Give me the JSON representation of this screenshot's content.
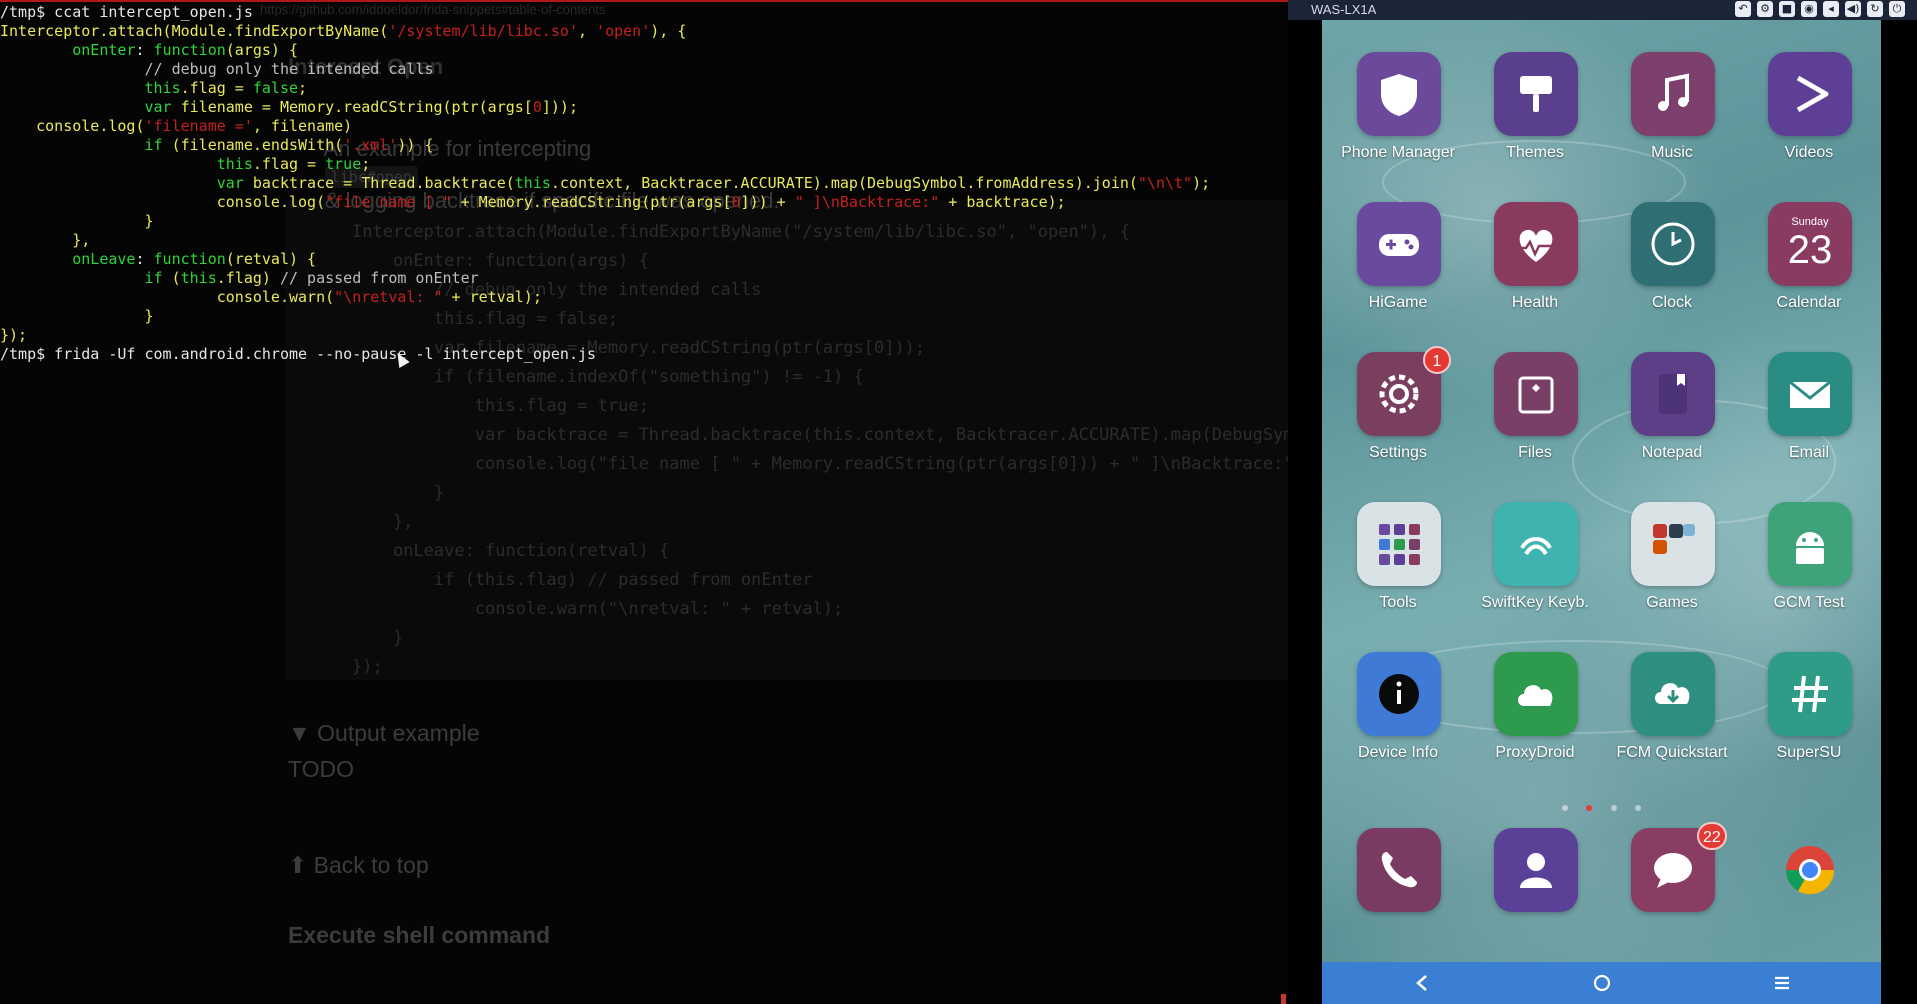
{
  "terminal": {
    "lines": [
      [
        {
          "t": "/tmp$ ccat intercept_open.js",
          "c": "c-prompt"
        }
      ],
      [
        {
          "t": "Interceptor.attach(Module.findExportByName(",
          "c": "c-fn"
        },
        {
          "t": "'/system/lib/libc.so'",
          "c": "c-str"
        },
        {
          "t": ", ",
          "c": "c-fn"
        },
        {
          "t": "'open'",
          "c": "c-str"
        },
        {
          "t": "), {",
          "c": "c-fn"
        }
      ],
      [
        {
          "t": "        onEnter",
          "c": "c-kw"
        },
        {
          "t": ": ",
          "c": "c-prompt"
        },
        {
          "t": "function",
          "c": "c-kw"
        },
        {
          "t": "(args) {",
          "c": "c-fn"
        }
      ],
      [
        {
          "t": "                // debug only the intended calls",
          "c": "c-cmt"
        }
      ],
      [
        {
          "t": "                this",
          "c": "c-kw"
        },
        {
          "t": ".flag = ",
          "c": "c-fn"
        },
        {
          "t": "false",
          "c": "c-kw"
        },
        {
          "t": ";",
          "c": "c-fn"
        }
      ],
      [
        {
          "t": "                var",
          "c": "c-kw"
        },
        {
          "t": " filename = Memory.readCString(ptr(args[",
          "c": "c-fn"
        },
        {
          "t": "0",
          "c": "c-num"
        },
        {
          "t": "]));",
          "c": "c-fn"
        }
      ],
      [
        {
          "t": "    console.log(",
          "c": "c-fn"
        },
        {
          "t": "'filename ='",
          "c": "c-str"
        },
        {
          "t": ", filename)",
          "c": "c-fn"
        }
      ],
      [
        {
          "t": "                if",
          "c": "c-kw"
        },
        {
          "t": " (filename.endsWith(",
          "c": "c-fn"
        },
        {
          "t": "'.xml'",
          "c": "c-str"
        },
        {
          "t": ")) {",
          "c": "c-fn"
        }
      ],
      [
        {
          "t": "                        this",
          "c": "c-kw"
        },
        {
          "t": ".flag = ",
          "c": "c-fn"
        },
        {
          "t": "true",
          "c": "c-kw"
        },
        {
          "t": ";",
          "c": "c-fn"
        }
      ],
      [
        {
          "t": "                        var",
          "c": "c-kw"
        },
        {
          "t": " backtrace = Thread.backtrace(",
          "c": "c-fn"
        },
        {
          "t": "this",
          "c": "c-kw"
        },
        {
          "t": ".context, Backtracer.ACCURATE).map(DebugSymbol.fromAddress).join(",
          "c": "c-fn"
        },
        {
          "t": "\"\\n\\t\"",
          "c": "c-str"
        },
        {
          "t": ");",
          "c": "c-fn"
        }
      ],
      [
        {
          "t": "                        console.log(",
          "c": "c-fn"
        },
        {
          "t": "\"file name [ \"",
          "c": "c-str"
        },
        {
          "t": " + Memory.readCString(ptr(args[",
          "c": "c-fn"
        },
        {
          "t": "0",
          "c": "c-num"
        },
        {
          "t": "])) + ",
          "c": "c-fn"
        },
        {
          "t": "\" ]\\nBacktrace:\"",
          "c": "c-str"
        },
        {
          "t": " + backtrace);",
          "c": "c-fn"
        }
      ],
      [
        {
          "t": "                }",
          "c": "c-fn"
        }
      ],
      [
        {
          "t": "        },",
          "c": "c-fn"
        }
      ],
      [
        {
          "t": "        onLeave",
          "c": "c-kw"
        },
        {
          "t": ": ",
          "c": "c-prompt"
        },
        {
          "t": "function",
          "c": "c-kw"
        },
        {
          "t": "(retval) {",
          "c": "c-fn"
        }
      ],
      [
        {
          "t": "                if",
          "c": "c-kw"
        },
        {
          "t": " (",
          "c": "c-fn"
        },
        {
          "t": "this",
          "c": "c-kw"
        },
        {
          "t": ".flag) ",
          "c": "c-fn"
        },
        {
          "t": "// passed from onEnter",
          "c": "c-cmt"
        }
      ],
      [
        {
          "t": "                        console.warn(",
          "c": "c-fn"
        },
        {
          "t": "\"\\nretval: \"",
          "c": "c-str"
        },
        {
          "t": " + retval);",
          "c": "c-fn"
        }
      ],
      [
        {
          "t": "                }",
          "c": "c-fn"
        }
      ],
      [
        {
          "t": "});",
          "c": "c-fn"
        }
      ],
      [
        {
          "t": "/tmp$ frida -Uf com.android.chrome --no-pause -l intercept_open.js",
          "c": "c-prompt"
        }
      ]
    ],
    "ghost": {
      "url": "https://github.com/iddoeldor/frida-snippets#table-of-contents",
      "section_title": "Intercept Open",
      "desc_pre": "An example for intercepting",
      "desc_code": "libc#open",
      "desc_post": "& logging backtrace if specific file was opened.",
      "code": [
        "Interceptor.attach(Module.findExportByName(\"/system/lib/libc.so\", \"open\"), {",
        "    onEnter: function(args) {",
        "        // debug only the intended calls",
        "        this.flag = false;",
        "        var filename = Memory.readCString(ptr(args[0]));",
        "        if (filename.indexOf(\"something\") != -1) {",
        "            this.flag = true;",
        "            var backtrace = Thread.backtrace(this.context, Backtracer.ACCURATE).map(DebugSymbol.",
        "            console.log(\"file name [ \" + Memory.readCString(ptr(args[0])) + \" ]\\nBacktrace:\" + b",
        "        }",
        "    },",
        "    onLeave: function(retval) {",
        "        if (this.flag) // passed from onEnter",
        "            console.warn(\"\\nretval: \" + retval);",
        "    }",
        "});"
      ],
      "output_example": "▼ Output example",
      "todo": "TODO",
      "back_to_top": "⬆ Back to top",
      "next_section": "Execute shell command"
    }
  },
  "emulator": {
    "title": "WAS-LX1A",
    "controls": [
      "↶",
      "⚙",
      "■",
      "◉",
      "◂",
      "◀)",
      "↻",
      "⏻"
    ],
    "apps": [
      {
        "label": "Phone Manager",
        "icon": "shield-icon",
        "color": "#6b4a9c",
        "badge": ""
      },
      {
        "label": "Themes",
        "icon": "brush-icon",
        "color": "#5a3f8f",
        "badge": ""
      },
      {
        "label": "Music",
        "icon": "music-icon",
        "color": "#7d3f6c",
        "badge": ""
      },
      {
        "label": "Videos",
        "icon": "play-icon",
        "color": "#5d3f96",
        "badge": ""
      },
      {
        "label": "HiGame",
        "icon": "gamepad-icon",
        "color": "#6a4a9e",
        "badge": ""
      },
      {
        "label": "Health",
        "icon": "heart-icon",
        "color": "#8a3a5d",
        "badge": ""
      },
      {
        "label": "Clock",
        "icon": "clock-icon",
        "color": "#2f6f74",
        "badge": ""
      },
      {
        "label": "Calendar",
        "icon": "calendar-icon",
        "color": "#8a3b62",
        "badge": "",
        "day": "23",
        "weekday": "Sunday"
      },
      {
        "label": "Settings",
        "icon": "gear-icon",
        "color": "#7a3f5e",
        "badge": "1"
      },
      {
        "label": "Files",
        "icon": "folder-icon",
        "color": "#7a3f66",
        "badge": ""
      },
      {
        "label": "Notepad",
        "icon": "notebook-icon",
        "color": "#5c3f86",
        "badge": ""
      },
      {
        "label": "Email",
        "icon": "mail-icon",
        "color": "#2b8c84",
        "badge": ""
      },
      {
        "label": "Tools",
        "icon": "folder-grid-icon",
        "color": "#d9e3e6",
        "badge": ""
      },
      {
        "label": "SwiftKey Keyb.",
        "icon": "swiftkey-icon",
        "color": "#3fb3b0",
        "badge": ""
      },
      {
        "label": "Games",
        "icon": "folder-games-icon",
        "color": "#d9e3e6",
        "badge": ""
      },
      {
        "label": "GCM Test",
        "icon": "android-icon",
        "color": "#3fa37a",
        "badge": ""
      },
      {
        "label": "Device Info",
        "icon": "info-icon",
        "color": "#3f7bd6",
        "badge": ""
      },
      {
        "label": "ProxyDroid",
        "icon": "cloud-icon",
        "color": "#2e9a4e",
        "badge": ""
      },
      {
        "label": "FCM Quickstart",
        "icon": "cloud-download-icon",
        "color": "#2f8f7e",
        "badge": ""
      },
      {
        "label": "SuperSU",
        "icon": "hash-icon",
        "color": "#2e9c86",
        "badge": ""
      }
    ],
    "dock": [
      {
        "label": "",
        "icon": "phone-icon",
        "color": "#7a3b62",
        "badge": ""
      },
      {
        "label": "",
        "icon": "contact-icon",
        "color": "#5a4096",
        "badge": ""
      },
      {
        "label": "",
        "icon": "message-icon",
        "color": "#8a3d62",
        "badge": "22"
      },
      {
        "label": "",
        "icon": "chrome-icon",
        "color": "transparent",
        "badge": ""
      }
    ],
    "nav": {
      "back": "back-icon",
      "home": "home-icon",
      "menu": "menu-icon"
    }
  },
  "colors": {
    "terminal_bg": "#050505",
    "nav_bar": "#3b7fd4",
    "badge": "#e53935"
  }
}
